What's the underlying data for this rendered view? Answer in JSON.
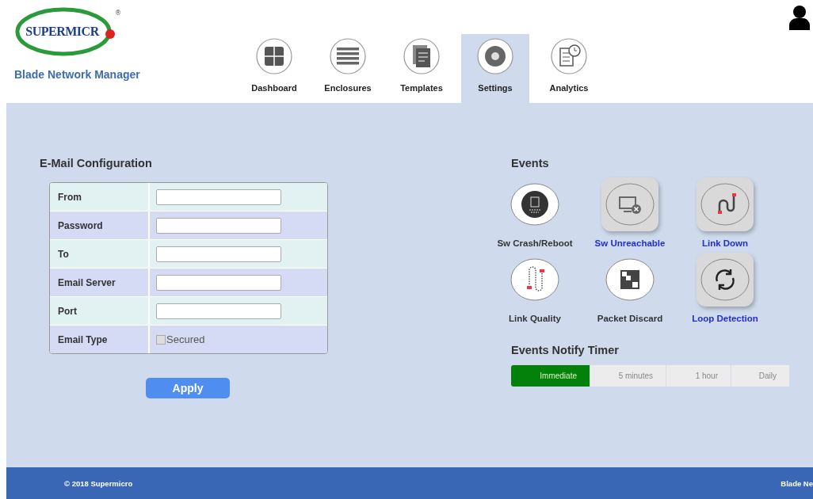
{
  "logo": {
    "wordmark": "SUPERMICR",
    "registered": "®"
  },
  "app_title": "Blade Network Manager",
  "nav": [
    {
      "label": "Dashboard",
      "selected": false
    },
    {
      "label": "Enclosures",
      "selected": false
    },
    {
      "label": "Templates",
      "selected": false
    },
    {
      "label": "Settings",
      "selected": true
    },
    {
      "label": "Analytics",
      "selected": false
    }
  ],
  "email_config": {
    "title": "E-Mail Configuration",
    "rows": [
      {
        "label": "From",
        "kind": "text"
      },
      {
        "label": "Password",
        "kind": "text"
      },
      {
        "label": "To",
        "kind": "text"
      },
      {
        "label": "Email Server",
        "kind": "text"
      },
      {
        "label": "Port",
        "kind": "text"
      },
      {
        "label": "Email Type",
        "kind": "checkbox",
        "option": "Secured",
        "checked": false
      }
    ],
    "apply": "Apply"
  },
  "events": {
    "title": "Events",
    "items": [
      {
        "label": "Sw Crash/Reboot",
        "selected": false
      },
      {
        "label": "Sw Unreachable",
        "selected": true
      },
      {
        "label": "Link Down",
        "selected": true
      },
      {
        "label": "Link Quality",
        "selected": false
      },
      {
        "label": "Packet Discard",
        "selected": false
      },
      {
        "label": "Loop Detection",
        "selected": true
      }
    ]
  },
  "timer": {
    "title": "Events Notify Timer",
    "options": [
      {
        "label": "Immediate",
        "selected": true
      },
      {
        "label": "5 minutes",
        "selected": false
      },
      {
        "label": "1 hour",
        "selected": false
      },
      {
        "label": "Daily",
        "selected": false
      }
    ]
  },
  "footer": {
    "copyright": "© 2018 Supermicro",
    "right": "Blade Ne"
  }
}
